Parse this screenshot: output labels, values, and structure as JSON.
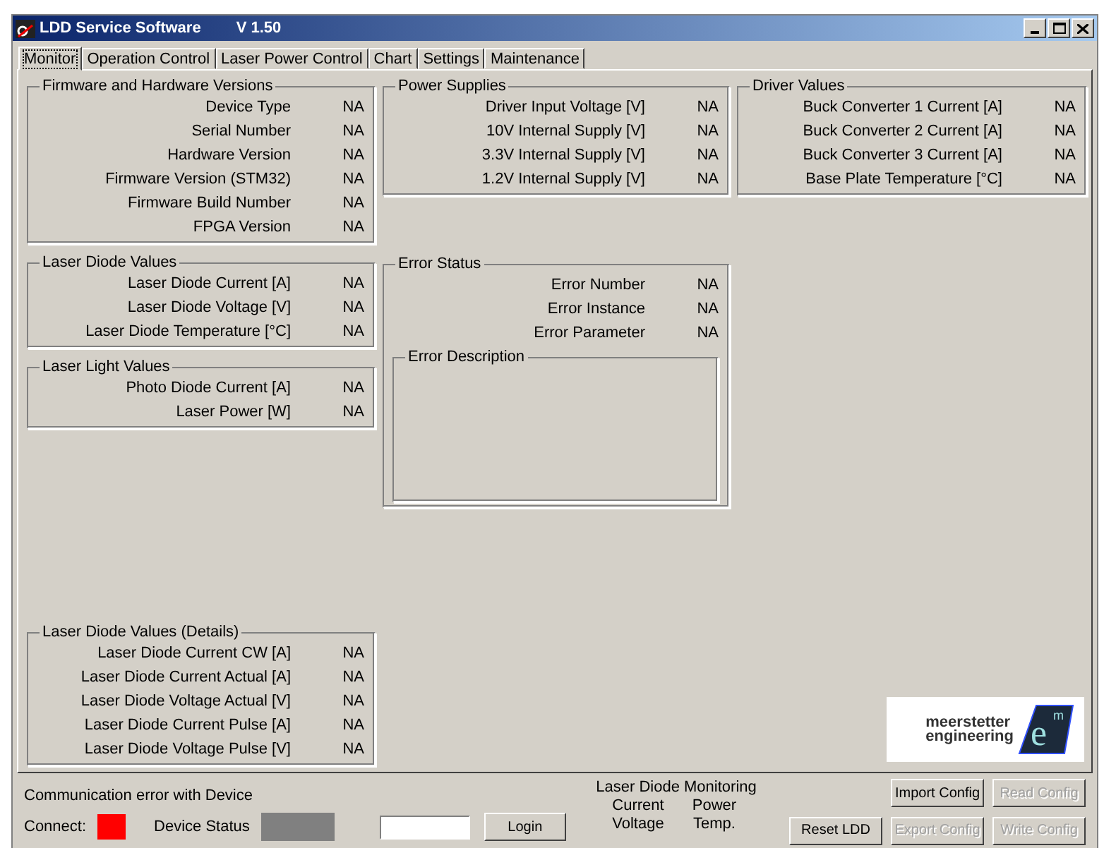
{
  "window": {
    "title": "LDD Service Software",
    "version": "V 1.50"
  },
  "tabs": [
    {
      "label": "Monitor",
      "selected": true
    },
    {
      "label": "Operation Control",
      "selected": false
    },
    {
      "label": "Laser Power Control",
      "selected": false
    },
    {
      "label": "Chart",
      "selected": false
    },
    {
      "label": "Settings",
      "selected": false
    },
    {
      "label": "Maintenance",
      "selected": false
    }
  ],
  "groups_left": [
    {
      "title": "Firmware and Hardware Versions",
      "rows": [
        {
          "label": "Device Type",
          "value": "NA"
        },
        {
          "label": "Serial Number",
          "value": "NA"
        },
        {
          "label": "Hardware Version",
          "value": "NA"
        },
        {
          "label": "Firmware Version (STM32)",
          "value": "NA"
        },
        {
          "label": "Firmware Build Number",
          "value": "NA"
        },
        {
          "label": "FPGA Version",
          "value": "NA"
        }
      ]
    },
    {
      "title": "Laser Diode Values",
      "rows": [
        {
          "label": "Laser Diode Current [A]",
          "value": "NA"
        },
        {
          "label": "Laser Diode Voltage [V]",
          "value": "NA"
        },
        {
          "label": "Laser Diode Temperature [°C]",
          "value": "NA"
        }
      ]
    },
    {
      "title": "Laser Light Values",
      "rows": [
        {
          "label": "Photo Diode Current [A]",
          "value": "NA"
        },
        {
          "label": "Laser Power [W]",
          "value": "NA"
        }
      ]
    }
  ],
  "details_group": {
    "title": "Laser Diode Values (Details)",
    "rows": [
      {
        "label": "Laser Diode Current CW [A]",
        "value": "NA"
      },
      {
        "label": "Laser Diode Current Actual [A]",
        "value": "NA"
      },
      {
        "label": "Laser Diode Voltage Actual [V]",
        "value": "NA"
      },
      {
        "label": "Laser Diode Current Pulse [A]",
        "value": "NA"
      },
      {
        "label": "Laser Diode Voltage Pulse [V]",
        "value": "NA"
      }
    ]
  },
  "power_supplies": {
    "title": "Power Supplies",
    "rows": [
      {
        "label": "Driver Input Voltage [V]",
        "value": "NA"
      },
      {
        "label": "10V Internal Supply [V]",
        "value": "NA"
      },
      {
        "label": "3.3V Internal Supply [V]",
        "value": "NA"
      },
      {
        "label": "1.2V Internal Supply [V]",
        "value": "NA"
      }
    ]
  },
  "error_status": {
    "title": "Error Status",
    "rows": [
      {
        "label": "Error Number",
        "value": "NA"
      },
      {
        "label": "Error Instance",
        "value": "NA"
      },
      {
        "label": "Error Parameter",
        "value": "NA"
      }
    ],
    "description_title": "Error Description"
  },
  "driver_values": {
    "title": "Driver Values",
    "rows": [
      {
        "label": "Buck Converter 1 Current [A]",
        "value": "NA"
      },
      {
        "label": "Buck Converter 2 Current [A]",
        "value": "NA"
      },
      {
        "label": "Buck Converter 3 Current [A]",
        "value": "NA"
      },
      {
        "label": "Base Plate Temperature [°C]",
        "value": "NA"
      }
    ]
  },
  "logo": {
    "line1": "meerstetter",
    "line2": "engineering",
    "mark": "e",
    "mark_sup": "m"
  },
  "status": {
    "message": "Communication error with Device",
    "connect_label": "Connect:",
    "connected": false,
    "device_status_label": "Device Status",
    "device_ready": false,
    "login_button": "Login"
  },
  "monitoring": {
    "title": "Laser Diode Monitoring",
    "labels": [
      "Current",
      "Power",
      "Voltage",
      "Temp."
    ]
  },
  "buttons": [
    {
      "label": "Import Config",
      "disabled": false
    },
    {
      "label": "Read Config",
      "disabled": true
    },
    {
      "label": "Reset LDD",
      "disabled": false
    },
    {
      "label": "Export Config",
      "disabled": true
    },
    {
      "label": "Write Config",
      "disabled": true
    }
  ]
}
